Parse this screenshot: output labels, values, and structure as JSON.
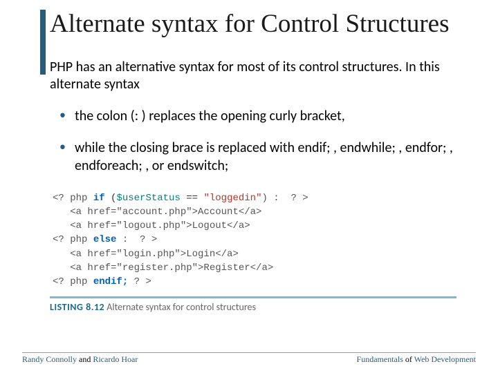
{
  "title": "Alternate syntax for Control Structures",
  "intro": "PHP has an alternative syntax for most of its control structures. In this alternate syntax",
  "bullets": [
    "the colon (: ) replaces the opening curly bracket,",
    "while the closing brace is replaced with endif; , endwhile; , endfor; , endforeach; , or endswitch;"
  ],
  "code": {
    "l1_open": "<? php ",
    "l1_if": "if ",
    "l1_paren": "(",
    "l1_var": "$userStatus",
    "l1_eq": " == ",
    "l1_str": "\"loggedin\"",
    "l1_close": ") :  ? >",
    "l2": "   <a href=\"account.php\">Account</a>",
    "l3": "   <a href=\"logout.php\">Logout</a>",
    "l4_open": "<? php ",
    "l4_else": "else",
    "l4_close": " :  ? >",
    "l5": "   <a href=\"login.php\">Login</a>",
    "l6": "   <a href=\"register.php\">Register</a>",
    "l7_open": "<? php ",
    "l7_endif": "endif;",
    "l7_close": " ? >"
  },
  "caption": {
    "label": "LISTING 8.12",
    "text": " Alternate syntax for control structures"
  },
  "footer": {
    "left_a": "Randy Connolly",
    "left_mid": " and ",
    "left_b": "Ricardo Hoar",
    "right_a": "Fundamentals",
    "right_mid": " of ",
    "right_b": "Web Development"
  }
}
